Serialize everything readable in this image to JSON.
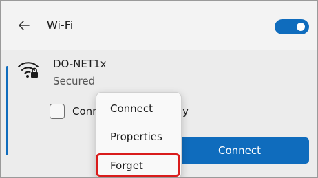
{
  "header": {
    "back_icon": "arrow-left-icon",
    "title": "Wi-Fi",
    "toggle_state": "on"
  },
  "network": {
    "wifi_icon": "wifi-secured-icon",
    "name": "DO-NET1x",
    "status": "Secured",
    "auto_connect_label": "Connect automatically",
    "auto_connect_checked": false,
    "connect_button_label": "Connect"
  },
  "context_menu": {
    "items": [
      {
        "label": "Connect"
      },
      {
        "label": "Properties"
      },
      {
        "label": "Forget"
      }
    ],
    "highlighted": "Forget"
  },
  "colors": {
    "accent": "#0f6cbd",
    "highlight": "#d91c1c",
    "background": "#f3f3f3"
  }
}
